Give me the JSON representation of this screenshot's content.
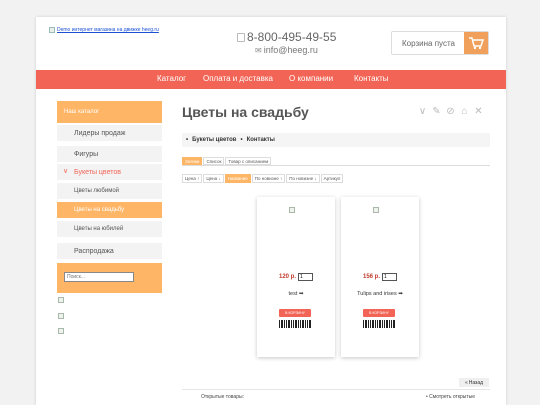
{
  "header": {
    "logo_alt": "Demo интернет магазина на движке heeg.ru",
    "phone": "8-800-495-49-55",
    "email": "info@heeg.ru",
    "cart_label": "Корзина пуста"
  },
  "nav": {
    "items": [
      "Каталог",
      "Оплата и доставка",
      "О компании",
      "Контакты"
    ]
  },
  "sidebar": {
    "heading": "Наш каталог",
    "items": [
      {
        "label": "Лидеры продаж"
      },
      {
        "label": "Фигуры"
      },
      {
        "label": "Букеты цветов"
      },
      {
        "label": "Цветы любимой"
      },
      {
        "label": "Цветы на свадьбу"
      },
      {
        "label": "Цветы на юбилей"
      },
      {
        "label": "Распродажа"
      }
    ],
    "search_placeholder": "Поиск..."
  },
  "main": {
    "title": "Цветы на свадьбу",
    "breadcrumbs": [
      "Букеты цветов",
      "Контакты"
    ],
    "view_tabs": [
      "Значки",
      "Список",
      "Товар с описанием"
    ],
    "sort_tabs": [
      "Цена ↑",
      "Цена ↓",
      "Название",
      "По новизне ↑",
      "По новизне ↓",
      "Артикул"
    ],
    "products": [
      {
        "price": "120 р.",
        "qty": "1",
        "name": "test",
        "buy_label": "В КОРЗИНУ"
      },
      {
        "price": "156 р.",
        "qty": "1",
        "name": "Tulips and irises",
        "buy_label": "В КОРЗИНУ"
      }
    ],
    "back_label": "Назад",
    "recent_label": "Открытые товары:",
    "recent_link": "Смотреть открытые"
  },
  "colors": {
    "nav_bg": "#f26556",
    "accent_orange": "#ffb566",
    "price_red": "#c0392b"
  },
  "icons": [
    "phone-icon",
    "mail-icon",
    "cart-icon",
    "chevron-down-icon",
    "check-icon",
    "edit-icon",
    "home-icon",
    "close-icon"
  ]
}
